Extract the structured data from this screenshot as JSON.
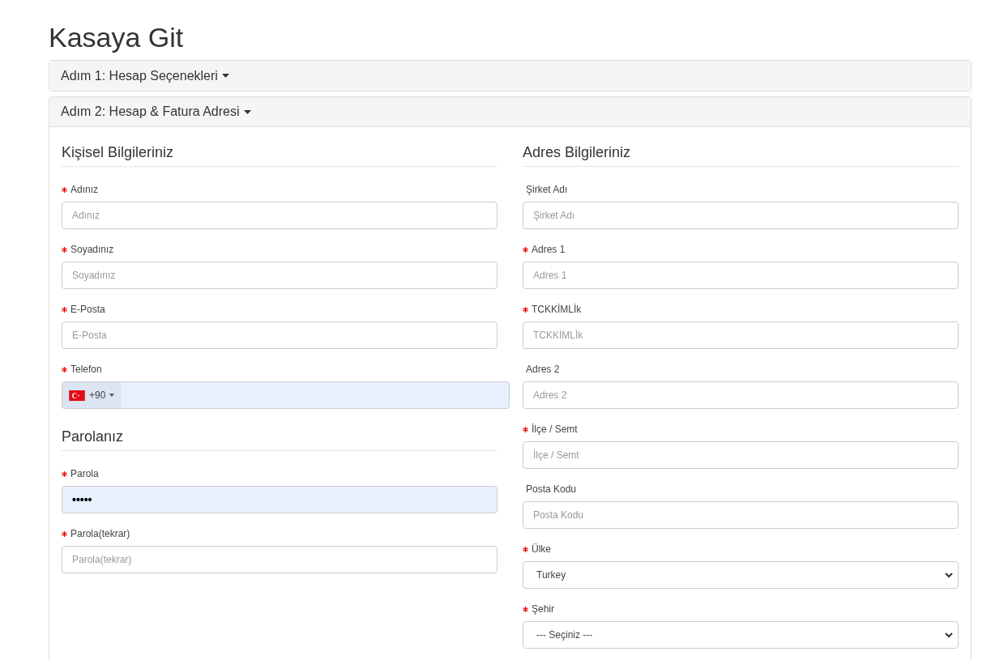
{
  "page_title": "Kasaya Git",
  "steps": [
    {
      "label": "Adım 1: Hesap Seçenekleri",
      "expanded": false
    },
    {
      "label": "Adım 2: Hesap & Fatura Adresi",
      "expanded": true
    }
  ],
  "columns": [
    {
      "sections": [
        {
          "heading": "Kişisel Bilgileriniz",
          "fields": [
            {
              "kind": "text",
              "label": "Adınız",
              "required": true,
              "placeholder": "Adınız",
              "autofilled": false
            },
            {
              "kind": "text",
              "label": "Soyadınız",
              "required": true,
              "placeholder": "Soyadınız",
              "autofilled": false
            },
            {
              "kind": "text",
              "label": "E-Posta",
              "required": true,
              "placeholder": "E-Posta",
              "autofilled": false
            },
            {
              "kind": "phone",
              "label": "Telefon",
              "required": true,
              "dial_code": "+90",
              "autofilled": true
            }
          ]
        },
        {
          "heading": "Parolanız",
          "fields": [
            {
              "kind": "text",
              "label": "Parola",
              "required": true,
              "value": "•••••",
              "autofilled": true
            },
            {
              "kind": "text",
              "label": "Parola(tekrar)",
              "required": true,
              "placeholder": "Parola(tekrar)",
              "autofilled": false
            }
          ]
        }
      ]
    },
    {
      "sections": [
        {
          "heading": "Adres Bilgileriniz",
          "fields": [
            {
              "kind": "text",
              "label": "Şirket Adı",
              "required": false,
              "placeholder": "Şirket Adı",
              "autofilled": false
            },
            {
              "kind": "text",
              "label": "Adres 1",
              "required": true,
              "placeholder": "Adres 1",
              "autofilled": false
            },
            {
              "kind": "text",
              "label": "TCKKİMLİk",
              "required": true,
              "placeholder": "TCKKİMLİk",
              "autofilled": false
            },
            {
              "kind": "text",
              "label": "Adres 2",
              "required": false,
              "placeholder": "Adres 2",
              "autofilled": false
            },
            {
              "kind": "text",
              "label": "İlçe / Semt",
              "required": true,
              "placeholder": "İlçe / Semt",
              "autofilled": false
            },
            {
              "kind": "text",
              "label": "Posta Kodu",
              "required": false,
              "placeholder": "Posta Kodu",
              "autofilled": false
            },
            {
              "kind": "select",
              "label": "Ülke",
              "required": true,
              "value": "Turkey"
            },
            {
              "kind": "select",
              "label": "Şehir",
              "required": true,
              "value": "--- Seçiniz ---"
            }
          ]
        }
      ]
    }
  ]
}
